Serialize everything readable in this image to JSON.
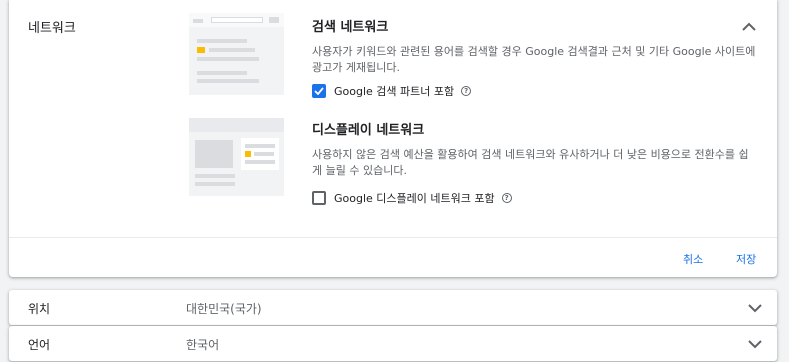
{
  "network_section": {
    "title": "네트워크",
    "search": {
      "title": "검색 네트워크",
      "description": "사용자가 키워드와 관련된 용어를 검색할 경우 Google 검색결과 근처 및 기타 Google 사이트에 광고가 게재됩니다.",
      "checkbox_label": "Google 검색 파트너 포함",
      "checked": true
    },
    "display": {
      "title": "디스플레이 네트워크",
      "description": "사용하지 않은 검색 예산을 활용하여 검색 네트워크와 유사하거나 더 낮은 비용으로 전환수를 쉽게 늘릴 수 있습니다.",
      "checkbox_label": "Google 디스플레이 네트워크 포함",
      "checked": false
    },
    "actions": {
      "cancel": "취소",
      "save": "저장"
    },
    "icons": {
      "collapse": "chevron-up-icon",
      "help": "help-icon",
      "check": "check-icon"
    }
  },
  "rows": [
    {
      "label": "위치",
      "value": "대한민국(국가)"
    },
    {
      "label": "언어",
      "value": "한국어"
    }
  ],
  "colors": {
    "accent": "#1a73e8",
    "illustration_highlight": "#fbbc04",
    "illustration_bg": "#f1f3f4"
  }
}
